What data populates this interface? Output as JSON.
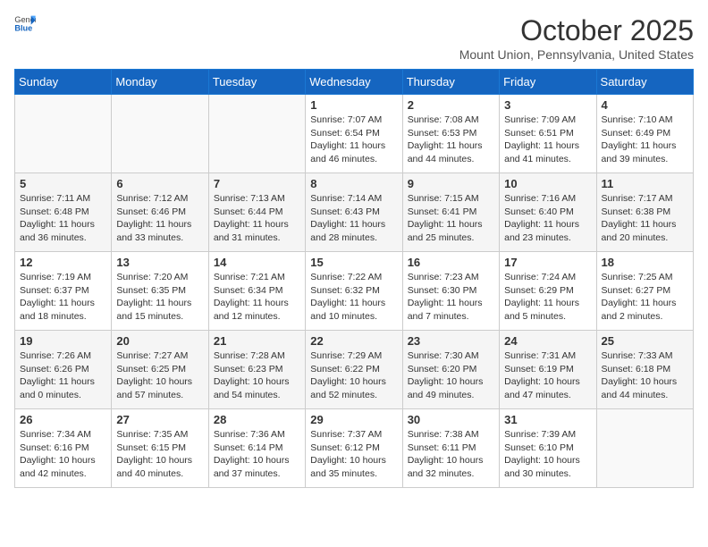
{
  "header": {
    "logo_general": "General",
    "logo_blue": "Blue",
    "month_year": "October 2025",
    "location": "Mount Union, Pennsylvania, United States"
  },
  "weekdays": [
    "Sunday",
    "Monday",
    "Tuesday",
    "Wednesday",
    "Thursday",
    "Friday",
    "Saturday"
  ],
  "weeks": [
    [
      {
        "day": "",
        "info": ""
      },
      {
        "day": "",
        "info": ""
      },
      {
        "day": "",
        "info": ""
      },
      {
        "day": "1",
        "info": "Sunrise: 7:07 AM\nSunset: 6:54 PM\nDaylight: 11 hours\nand 46 minutes."
      },
      {
        "day": "2",
        "info": "Sunrise: 7:08 AM\nSunset: 6:53 PM\nDaylight: 11 hours\nand 44 minutes."
      },
      {
        "day": "3",
        "info": "Sunrise: 7:09 AM\nSunset: 6:51 PM\nDaylight: 11 hours\nand 41 minutes."
      },
      {
        "day": "4",
        "info": "Sunrise: 7:10 AM\nSunset: 6:49 PM\nDaylight: 11 hours\nand 39 minutes."
      }
    ],
    [
      {
        "day": "5",
        "info": "Sunrise: 7:11 AM\nSunset: 6:48 PM\nDaylight: 11 hours\nand 36 minutes."
      },
      {
        "day": "6",
        "info": "Sunrise: 7:12 AM\nSunset: 6:46 PM\nDaylight: 11 hours\nand 33 minutes."
      },
      {
        "day": "7",
        "info": "Sunrise: 7:13 AM\nSunset: 6:44 PM\nDaylight: 11 hours\nand 31 minutes."
      },
      {
        "day": "8",
        "info": "Sunrise: 7:14 AM\nSunset: 6:43 PM\nDaylight: 11 hours\nand 28 minutes."
      },
      {
        "day": "9",
        "info": "Sunrise: 7:15 AM\nSunset: 6:41 PM\nDaylight: 11 hours\nand 25 minutes."
      },
      {
        "day": "10",
        "info": "Sunrise: 7:16 AM\nSunset: 6:40 PM\nDaylight: 11 hours\nand 23 minutes."
      },
      {
        "day": "11",
        "info": "Sunrise: 7:17 AM\nSunset: 6:38 PM\nDaylight: 11 hours\nand 20 minutes."
      }
    ],
    [
      {
        "day": "12",
        "info": "Sunrise: 7:19 AM\nSunset: 6:37 PM\nDaylight: 11 hours\nand 18 minutes."
      },
      {
        "day": "13",
        "info": "Sunrise: 7:20 AM\nSunset: 6:35 PM\nDaylight: 11 hours\nand 15 minutes."
      },
      {
        "day": "14",
        "info": "Sunrise: 7:21 AM\nSunset: 6:34 PM\nDaylight: 11 hours\nand 12 minutes."
      },
      {
        "day": "15",
        "info": "Sunrise: 7:22 AM\nSunset: 6:32 PM\nDaylight: 11 hours\nand 10 minutes."
      },
      {
        "day": "16",
        "info": "Sunrise: 7:23 AM\nSunset: 6:30 PM\nDaylight: 11 hours\nand 7 minutes."
      },
      {
        "day": "17",
        "info": "Sunrise: 7:24 AM\nSunset: 6:29 PM\nDaylight: 11 hours\nand 5 minutes."
      },
      {
        "day": "18",
        "info": "Sunrise: 7:25 AM\nSunset: 6:27 PM\nDaylight: 11 hours\nand 2 minutes."
      }
    ],
    [
      {
        "day": "19",
        "info": "Sunrise: 7:26 AM\nSunset: 6:26 PM\nDaylight: 11 hours\nand 0 minutes."
      },
      {
        "day": "20",
        "info": "Sunrise: 7:27 AM\nSunset: 6:25 PM\nDaylight: 10 hours\nand 57 minutes."
      },
      {
        "day": "21",
        "info": "Sunrise: 7:28 AM\nSunset: 6:23 PM\nDaylight: 10 hours\nand 54 minutes."
      },
      {
        "day": "22",
        "info": "Sunrise: 7:29 AM\nSunset: 6:22 PM\nDaylight: 10 hours\nand 52 minutes."
      },
      {
        "day": "23",
        "info": "Sunrise: 7:30 AM\nSunset: 6:20 PM\nDaylight: 10 hours\nand 49 minutes."
      },
      {
        "day": "24",
        "info": "Sunrise: 7:31 AM\nSunset: 6:19 PM\nDaylight: 10 hours\nand 47 minutes."
      },
      {
        "day": "25",
        "info": "Sunrise: 7:33 AM\nSunset: 6:18 PM\nDaylight: 10 hours\nand 44 minutes."
      }
    ],
    [
      {
        "day": "26",
        "info": "Sunrise: 7:34 AM\nSunset: 6:16 PM\nDaylight: 10 hours\nand 42 minutes."
      },
      {
        "day": "27",
        "info": "Sunrise: 7:35 AM\nSunset: 6:15 PM\nDaylight: 10 hours\nand 40 minutes."
      },
      {
        "day": "28",
        "info": "Sunrise: 7:36 AM\nSunset: 6:14 PM\nDaylight: 10 hours\nand 37 minutes."
      },
      {
        "day": "29",
        "info": "Sunrise: 7:37 AM\nSunset: 6:12 PM\nDaylight: 10 hours\nand 35 minutes."
      },
      {
        "day": "30",
        "info": "Sunrise: 7:38 AM\nSunset: 6:11 PM\nDaylight: 10 hours\nand 32 minutes."
      },
      {
        "day": "31",
        "info": "Sunrise: 7:39 AM\nSunset: 6:10 PM\nDaylight: 10 hours\nand 30 minutes."
      },
      {
        "day": "",
        "info": ""
      }
    ]
  ]
}
